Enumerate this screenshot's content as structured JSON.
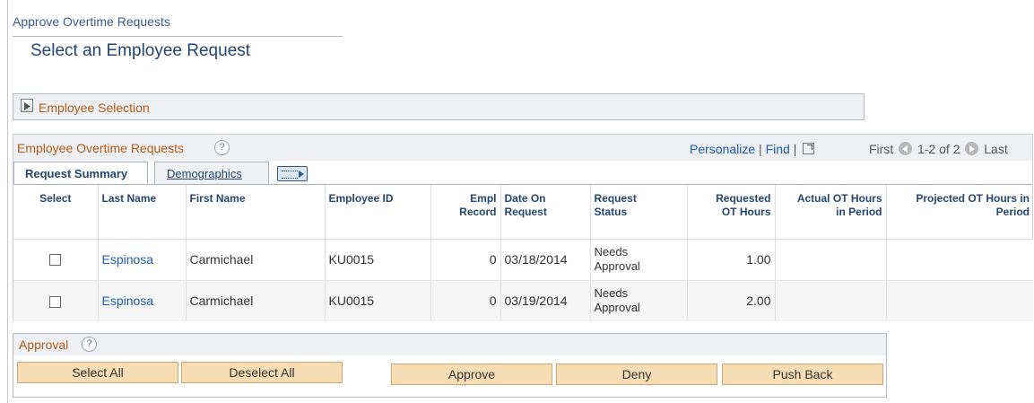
{
  "breadcrumb": "Approve Overtime Requests",
  "page_title": "Select an Employee Request",
  "employee_selection": {
    "label": "Employee Selection"
  },
  "grid": {
    "title": "Employee Overtime Requests",
    "help": "?",
    "personalize": "Personalize",
    "separator": "|",
    "find": "Find",
    "pager": {
      "first": "First",
      "range": "1-2 of 2",
      "last": "Last"
    },
    "tabs": [
      {
        "label": "Request Summary",
        "active": true
      },
      {
        "label": "Demographics",
        "active": false
      }
    ],
    "columns": {
      "select": "Select",
      "last_name": "Last Name",
      "first_name": "First Name",
      "employee_id": "Employee ID",
      "empl_record_1": "Empl",
      "empl_record_2": "Record",
      "date_on_request_1": "Date On",
      "date_on_request_2": "Request",
      "request_status_1": "Request",
      "request_status_2": "Status",
      "requested_ot_1": "Requested",
      "requested_ot_2": "OT Hours",
      "actual_ot_1": "Actual OT Hours",
      "actual_ot_2": "in Period",
      "projected_ot_1": "Projected OT Hours in",
      "projected_ot_2": "Period"
    },
    "rows": [
      {
        "last_name": "Espinosa",
        "first_name": "Carmichael",
        "employee_id": "KU0015",
        "empl_record": "0",
        "date_on_request": "03/18/2014",
        "status_1": "Needs",
        "status_2": "Approval",
        "requested_ot_hours": "1.00",
        "actual_ot_hours": "",
        "projected_ot_hours": ""
      },
      {
        "last_name": "Espinosa",
        "first_name": "Carmichael",
        "employee_id": "KU0015",
        "empl_record": "0",
        "date_on_request": "03/19/2014",
        "status_1": "Needs",
        "status_2": "Approval",
        "requested_ot_hours": "2.00",
        "actual_ot_hours": "",
        "projected_ot_hours": ""
      }
    ]
  },
  "approval": {
    "title": "Approval",
    "help": "?",
    "buttons": {
      "select_all": "Select All",
      "deselect_all": "Deselect All",
      "approve": "Approve",
      "deny": "Deny",
      "push_back": "Push Back"
    }
  },
  "colors": {
    "section_title": "#b35b17",
    "link": "#1b5eab",
    "header_text": "#24466f",
    "button_bg": "#f8dcb4"
  }
}
